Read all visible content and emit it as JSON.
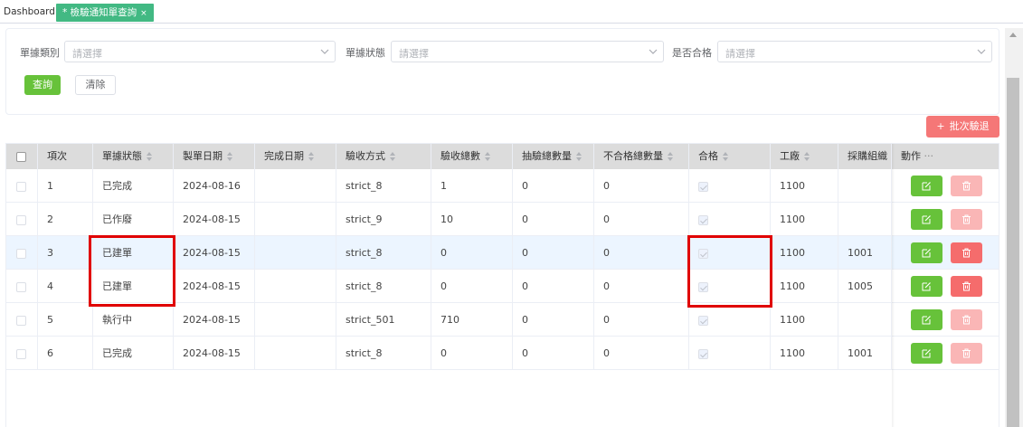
{
  "tabs": [
    {
      "label": "Dashboard"
    },
    {
      "label": "* 檢驗通知單查詢",
      "close": "×"
    }
  ],
  "filters": {
    "doc_type": {
      "label": "單據類別",
      "placeholder": "請選擇"
    },
    "doc_status": {
      "label": "單據狀態",
      "placeholder": "請選擇"
    },
    "passed": {
      "label": "是否合格",
      "placeholder": "請選擇"
    },
    "query_label": "查詢",
    "clear_label": "清除"
  },
  "batch_button": {
    "icon": "plus-icon",
    "label": "批次驗退"
  },
  "table": {
    "columns": [
      "項次",
      "單據狀態",
      "製單日期",
      "完成日期",
      "驗收方式",
      "驗收總數",
      "抽驗總數量",
      "不合格總數量",
      "合格",
      "工廠",
      "採購組織",
      "動作"
    ],
    "action_more": "···",
    "rows": [
      {
        "no": "1",
        "status": "已完成",
        "created": "2024-08-16",
        "completed": "",
        "method": "strict_8",
        "total": "1",
        "sampled": "0",
        "rejected": "0",
        "passed": true,
        "factory": "1100",
        "org": "",
        "delete_enabled": false
      },
      {
        "no": "2",
        "status": "已作廢",
        "created": "2024-08-15",
        "completed": "",
        "method": "strict_9",
        "total": "10",
        "sampled": "0",
        "rejected": "0",
        "passed": true,
        "factory": "1100",
        "org": "",
        "delete_enabled": false
      },
      {
        "no": "3",
        "status": "已建單",
        "created": "2024-08-15",
        "completed": "",
        "method": "strict_8",
        "total": "0",
        "sampled": "0",
        "rejected": "0",
        "passed": true,
        "factory": "1100",
        "org": "1001",
        "delete_enabled": true
      },
      {
        "no": "4",
        "status": "已建單",
        "created": "2024-08-15",
        "completed": "",
        "method": "strict_8",
        "total": "0",
        "sampled": "0",
        "rejected": "0",
        "passed": true,
        "factory": "1100",
        "org": "1005",
        "delete_enabled": true
      },
      {
        "no": "5",
        "status": "執行中",
        "created": "2024-08-15",
        "completed": "",
        "method": "strict_501",
        "total": "710",
        "sampled": "0",
        "rejected": "0",
        "passed": true,
        "factory": "1100",
        "org": "",
        "delete_enabled": false
      },
      {
        "no": "6",
        "status": "已完成",
        "created": "2024-08-15",
        "completed": "",
        "method": "strict_8",
        "total": "0",
        "sampled": "0",
        "rejected": "0",
        "passed": true,
        "factory": "1100",
        "org": "1001",
        "delete_enabled": false
      }
    ]
  },
  "colors": {
    "primary_green": "#67c23a",
    "danger_red": "#f56c6c",
    "tab_active": "#42b983",
    "highlight_box": "#e00000",
    "row_hover": "#ecf5ff"
  }
}
